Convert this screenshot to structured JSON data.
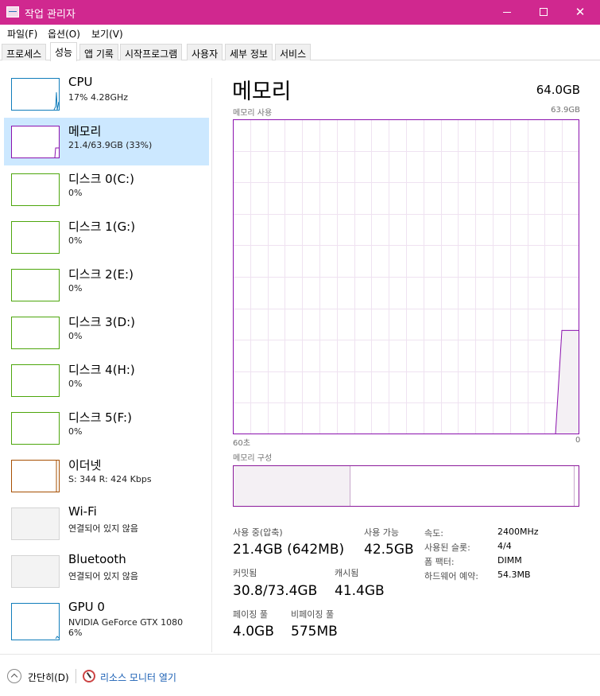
{
  "window": {
    "title": "작업 관리자",
    "minimize": "—",
    "maximize": "☐",
    "close": "✕"
  },
  "menu": [
    "파일(F)",
    "옵션(O)",
    "보기(V)"
  ],
  "tabs": [
    "프로세스",
    "성능",
    "앱 기록",
    "시작프로그램",
    "사용자",
    "세부 정보",
    "서비스"
  ],
  "active_tab": "성능",
  "sidebar": [
    {
      "name": "CPU",
      "sub": "17% 4.28GHz",
      "color": "#117dbb"
    },
    {
      "name": "메모리",
      "sub": "21.4/63.9GB (33%)",
      "color": "#8b12ae"
    },
    {
      "name": "디스크 0(C:)",
      "sub": "0%",
      "color": "#4da60c"
    },
    {
      "name": "디스크 1(G:)",
      "sub": "0%",
      "color": "#4da60c"
    },
    {
      "name": "디스크 2(E:)",
      "sub": "0%",
      "color": "#4da60c"
    },
    {
      "name": "디스크 3(D:)",
      "sub": "0%",
      "color": "#4da60c"
    },
    {
      "name": "디스크 4(H:)",
      "sub": "0%",
      "color": "#4da60c"
    },
    {
      "name": "디스크 5(F:)",
      "sub": "0%",
      "color": "#4da60c"
    },
    {
      "name": "이더넷",
      "sub": "S: 344  R: 424 Kbps",
      "color": "#a74f01"
    },
    {
      "name": "Wi-Fi",
      "sub": "연결되어 있지 않음",
      "color": "#d4d4d4"
    },
    {
      "name": "Bluetooth",
      "sub": "연결되어 있지 않음",
      "color": "#d4d4d4"
    },
    {
      "name": "GPU 0",
      "sub": "NVIDIA GeForce GTX 1080",
      "sub2": "6%",
      "color": "#117dbb"
    }
  ],
  "main": {
    "title": "메모리",
    "capacity": "64.0GB",
    "usage_label": "메모리 사용",
    "usage_max": "63.9GB",
    "graph_left_label": "60초",
    "graph_right_label": "0",
    "composition_label": "메모리 구성",
    "stats": {
      "in_use_label": "사용 중(압축)",
      "in_use_value": "21.4GB (642MB)",
      "available_label": "사용 가능",
      "available_value": "42.5GB",
      "committed_label": "커밋됨",
      "committed_value": "30.8/73.4GB",
      "cached_label": "캐시됨",
      "cached_value": "41.4GB",
      "paged_label": "페이징 풀",
      "paged_value": "4.0GB",
      "nonpaged_label": "비페이징 풀",
      "nonpaged_value": "575MB"
    },
    "details": [
      {
        "key": "속도:",
        "value": "2400MHz"
      },
      {
        "key": "사용된 슬롯:",
        "value": "4/4"
      },
      {
        "key": "폼 팩터:",
        "value": "DIMM"
      },
      {
        "key": "하드웨어 예약:",
        "value": "54.3MB"
      }
    ],
    "memory_percent": 33,
    "accent": "#8b12ae"
  },
  "footer": {
    "fewer_details": "간단히(D)",
    "resource_monitor": "리소스 모니터 열기"
  }
}
